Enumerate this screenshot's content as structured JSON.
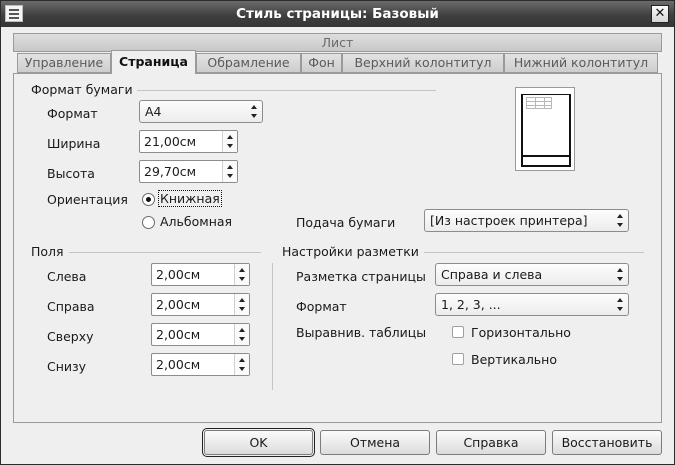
{
  "window": {
    "title": "Стиль страницы: Базовый",
    "close_glyph": "✕"
  },
  "tabs": {
    "row1": "Лист",
    "row2": [
      {
        "label": "Управление"
      },
      {
        "label": "Страница",
        "active": true
      },
      {
        "label": "Обрамление"
      },
      {
        "label": "Фон"
      },
      {
        "label": "Верхний колонтитул"
      },
      {
        "label": "Нижний колонтитул"
      }
    ]
  },
  "paper_format": {
    "section_title": "Формат бумаги",
    "format_label": "Формат",
    "format_value": "A4",
    "width_label": "Ширина",
    "width_value": "21,00см",
    "height_label": "Высота",
    "height_value": "29,70см",
    "orientation_label": "Ориентация",
    "portrait_label": "Книжная",
    "landscape_label": "Альбомная",
    "orientation_selected": "portrait",
    "paper_tray_label": "Подача бумаги",
    "paper_tray_value": "[Из настроек принтера]"
  },
  "margins": {
    "section_title": "Поля",
    "left_label": "Слева",
    "left_value": "2,00см",
    "right_label": "Справа",
    "right_value": "2,00см",
    "top_label": "Сверху",
    "top_value": "2,00см",
    "bottom_label": "Снизу",
    "bottom_value": "2,00см"
  },
  "layout": {
    "section_title": "Настройки разметки",
    "page_layout_label": "Разметка страницы",
    "page_layout_value": "Справа и слева",
    "format_label": "Формат",
    "format_value": "1, 2, 3, ...",
    "table_align_label": "Выравнив. таблицы",
    "horizontal_label": "Горизонтально",
    "horizontal_checked": false,
    "vertical_label": "Вертикально",
    "vertical_checked": false
  },
  "buttons": {
    "ok": "OK",
    "cancel": "Отмена",
    "help": "Справка",
    "reset": "Восстановить"
  },
  "icons": {
    "window_icon": "window-menu-icon",
    "close": "close-icon",
    "spin": "spin-arrows-icon",
    "dropdown": "dropdown-arrows-icon"
  }
}
